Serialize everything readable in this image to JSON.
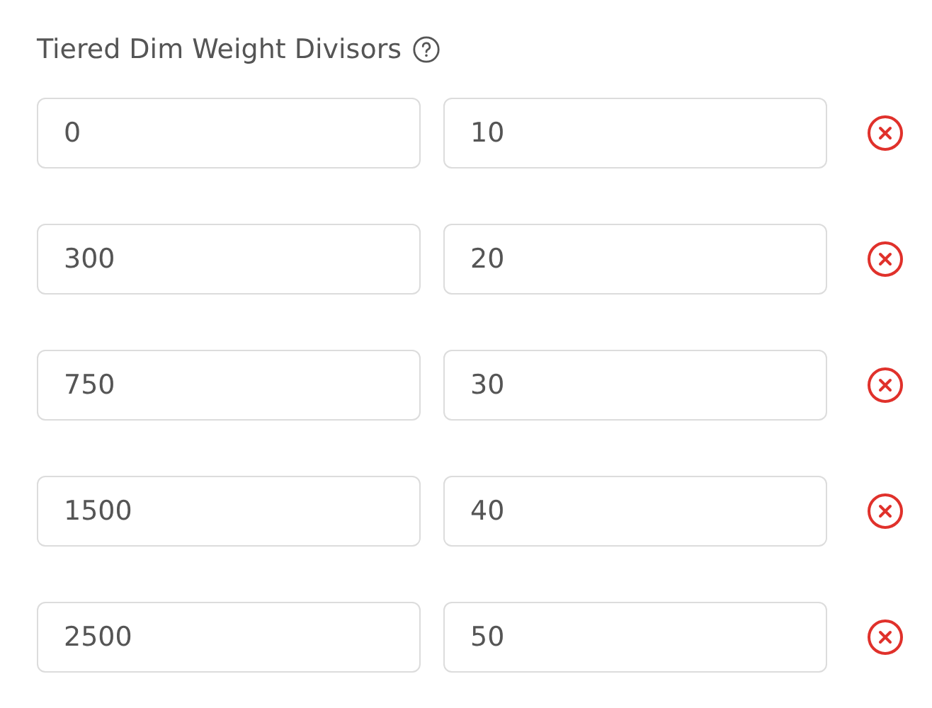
{
  "title": "Tiered Dim Weight Divisors",
  "tiers": [
    {
      "min": "0",
      "divisor": "10"
    },
    {
      "min": "300",
      "divisor": "20"
    },
    {
      "min": "750",
      "divisor": "30"
    },
    {
      "min": "1500",
      "divisor": "40"
    },
    {
      "min": "2500",
      "divisor": "50"
    }
  ]
}
